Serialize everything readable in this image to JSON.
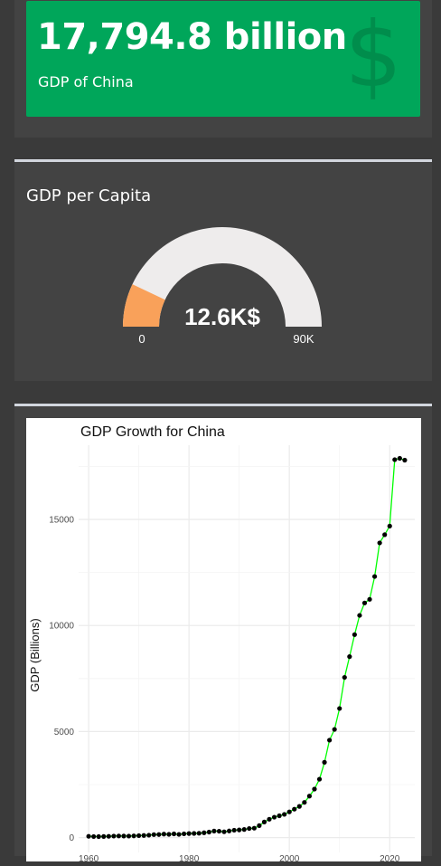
{
  "valuebox": {
    "value": "17,794.8 billion",
    "label": "GDP of China",
    "icon": "dollar-sign-icon",
    "color": "#00a65a"
  },
  "gauge_box": {
    "title": "GDP per Capita",
    "value_text": "12.6K$",
    "min_label": "0",
    "max_label": "90K",
    "value": 12.6,
    "min": 0,
    "max": 90,
    "fill_color": "#f9a15a",
    "track_color": "#eeecec"
  },
  "chart_data": {
    "type": "line",
    "title": "GDP Growth for China",
    "xlabel": "",
    "ylabel": "GDP (Billions)",
    "xlim": [
      1958,
      2025
    ],
    "ylim": [
      -700,
      18500
    ],
    "x_ticks": [
      1960,
      1980,
      2000,
      2020
    ],
    "y_ticks": [
      0,
      5000,
      10000,
      15000
    ],
    "grid": true,
    "line_color": "#00ff00",
    "point_color": "#000000",
    "series": [
      {
        "x": [
          1960,
          1961,
          1962,
          1963,
          1964,
          1965,
          1966,
          1967,
          1968,
          1969,
          1970,
          1971,
          1972,
          1973,
          1974,
          1975,
          1976,
          1977,
          1978,
          1979,
          1980,
          1981,
          1982,
          1983,
          1984,
          1985,
          1986,
          1987,
          1988,
          1989,
          1990,
          1991,
          1992,
          1993,
          1994,
          1995,
          1996,
          1997,
          1998,
          1999,
          2000,
          2001,
          2002,
          2003,
          2004,
          2005,
          2006,
          2007,
          2008,
          2009,
          2010,
          2011,
          2012,
          2013,
          2014,
          2015,
          2016,
          2017,
          2018,
          2019,
          2020,
          2021,
          2022,
          2023
        ],
        "y": [
          60,
          50,
          47,
          51,
          60,
          71,
          77,
          73,
          71,
          80,
          93,
          100,
          114,
          139,
          144,
          163,
          154,
          175,
          150,
          178,
          191,
          195,
          204,
          228,
          259,
          309,
          301,
          273,
          312,
          348,
          361,
          383,
          427,
          444,
          564,
          734,
          864,
          962,
          1029,
          1094,
          1211,
          1339,
          1471,
          1660,
          1955,
          2286,
          2752,
          3550,
          4594,
          5101,
          6087,
          7552,
          8532,
          9570,
          10476,
          11062,
          11233,
          12310,
          13895,
          14280,
          14688,
          17820,
          17882,
          17795
        ]
      }
    ]
  }
}
